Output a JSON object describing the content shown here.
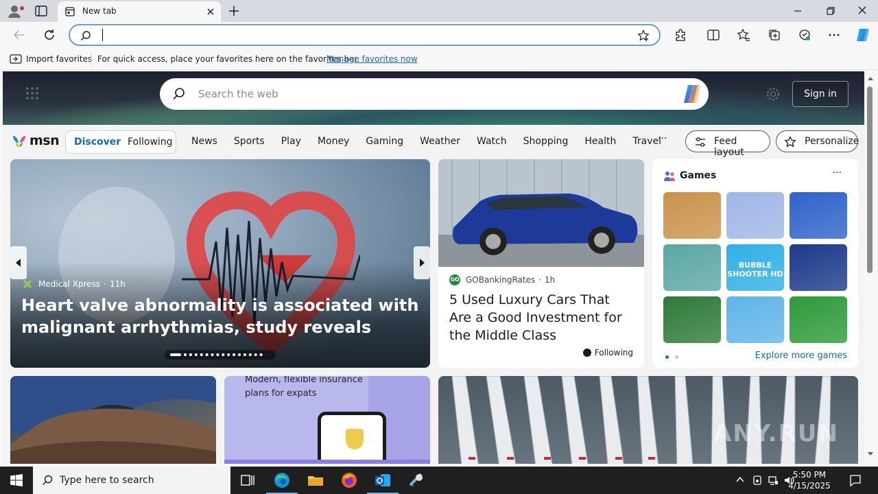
{
  "browser": {
    "tab_title": "New tab",
    "address_value": "",
    "favorites_bar": {
      "import_label": "Import favorites",
      "message": "For quick access, place your favorites here on the favorites bar.",
      "manage_link": "Manage favorites now"
    }
  },
  "msn": {
    "search_placeholder": "Search the web",
    "sign_in_label": "Sign in",
    "logo_text": "msn",
    "segments": {
      "discover": "Discover",
      "following": "Following"
    },
    "nav": [
      "News",
      "Sports",
      "Play",
      "Money",
      "Gaming",
      "Weather",
      "Watch",
      "Shopping",
      "Health",
      "Travel"
    ],
    "more_label": "···",
    "feed_layout_label": "Feed layout",
    "personalize_label": "Personalize"
  },
  "hero": {
    "source": "Medical Xpress",
    "time": "11h",
    "title": "Heart valve abnormality is associated with malignant arrhythmias, study reveals",
    "slides_total": 16,
    "slide_active": 1
  },
  "car_story": {
    "source": "GOBankingRates",
    "source_logo_text": "GO",
    "time": "1h",
    "title": "5 Used Luxury Cars That Are a Good Investment for the Middle Class",
    "follow_label": "Following"
  },
  "games": {
    "title": "Games",
    "more_label": "···",
    "explore_label": "Explore more games",
    "tiles": [
      {
        "name": "wood-puzzle-game",
        "color": "#c9934b",
        "label": ""
      },
      {
        "name": "makeup-game",
        "color": "#9fb6e6",
        "label": ""
      },
      {
        "name": "match-jewels-game",
        "color": "#2f62c9",
        "label": ""
      },
      {
        "name": "hospital-game",
        "color": "#5ba7a3",
        "label": ""
      },
      {
        "name": "bubble-shooter-game",
        "color": "#2fb0e6",
        "label": "BUBBLE SHOOTER HD"
      },
      {
        "name": "block-puzzle-game",
        "color": "#1c3a8a",
        "label": ""
      },
      {
        "name": "mahjong-game",
        "color": "#2f7a3a",
        "label": ""
      },
      {
        "name": "restaurant-game",
        "color": "#5fb4e8",
        "label": ""
      },
      {
        "name": "gem-game",
        "color": "#2e9a3a",
        "label": ""
      }
    ]
  },
  "insurance_card": {
    "text": "Modern, flexible insurance plans for expats"
  },
  "watermark": "ANY.RUN",
  "taskbar": {
    "search_placeholder": "Type here to search",
    "time": "5:50 PM",
    "date": "4/15/2025"
  }
}
